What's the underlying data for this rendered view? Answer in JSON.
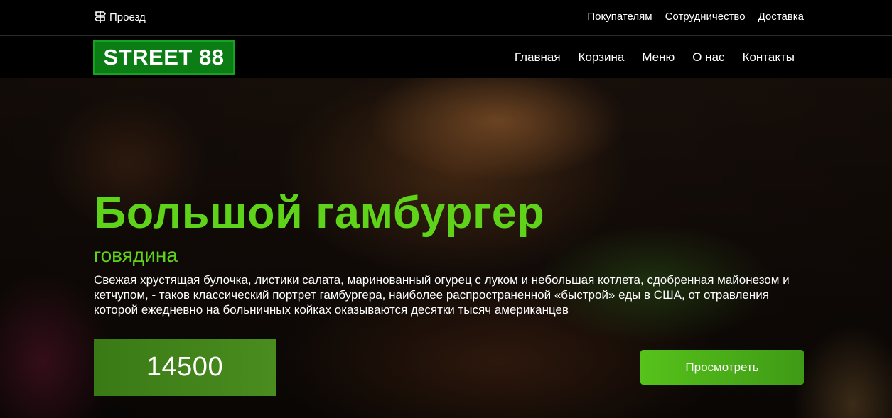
{
  "topbar": {
    "route_label": "Проезд",
    "links": [
      "Покупателям",
      "Сотрудничество",
      "Доставка"
    ]
  },
  "navbar": {
    "logo": "STREET 88",
    "menu": [
      "Главная",
      "Корзина",
      "Меню",
      "О нас",
      "Контакты"
    ]
  },
  "hero": {
    "title": "Большой гамбургер",
    "subtitle": "говядина",
    "description": "Свежая хрустящая булочка, листики салата, маринованный огурец с луком и небольшая котлета, сдобренная майонезом и кетчупом, - таков классический портрет гамбургера, наиболее распространенной «быстрой» еды в США, от отравления которой ежедневно на больничных койках оказываются десятки тысяч американцев",
    "price": "14500",
    "view_button": "Просмотреть"
  },
  "colors": {
    "accent_green": "#5fd319",
    "logo_bg": "#0c7d15",
    "price_bg": "#3a7a16",
    "button_bg": "#56c21a"
  },
  "icons": {
    "route": "signpost-icon"
  }
}
